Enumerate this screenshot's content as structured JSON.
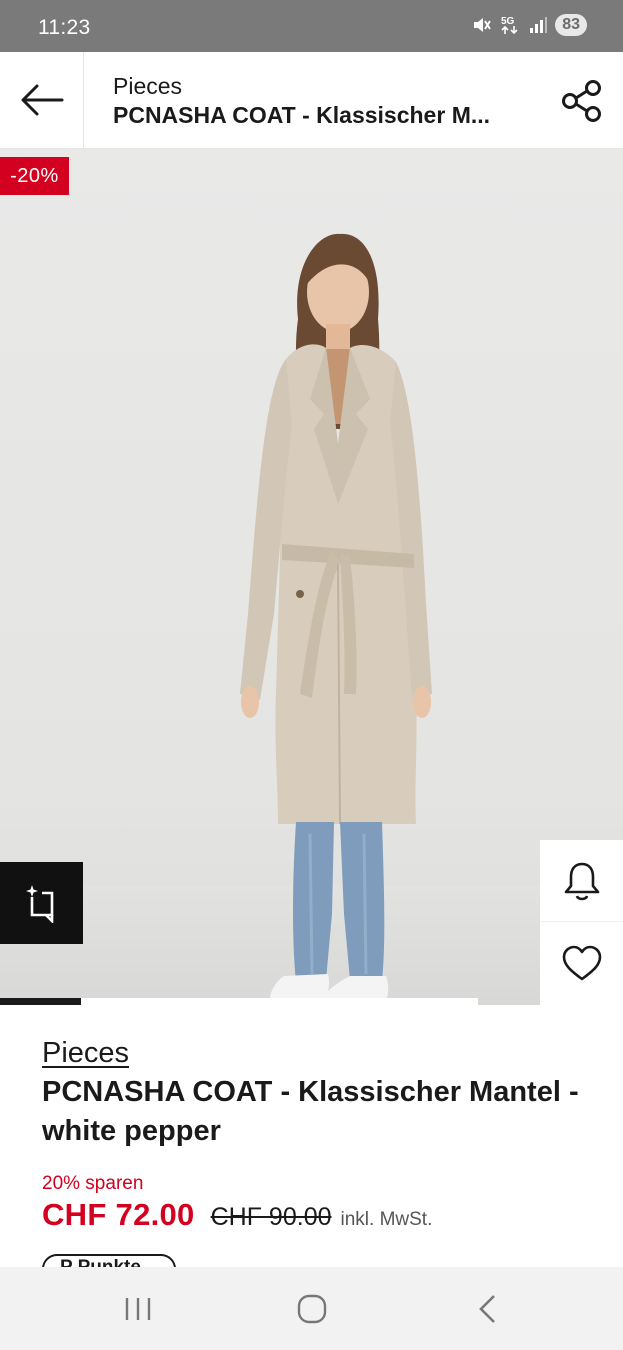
{
  "status_bar": {
    "time": "11:23",
    "battery": "83",
    "icons": [
      "mute-icon",
      "5g-icon",
      "signal-icon",
      "battery-icon"
    ]
  },
  "header": {
    "brand": "Pieces",
    "product_title": "PCNASHA COAT - Klassischer M..."
  },
  "image": {
    "discount_badge": "-20%",
    "carousel_progress": 0.17
  },
  "product": {
    "brand": "Pieces",
    "name": "PCNASHA COAT - Klassischer Mantel - white pepper",
    "savings": "20% sparen",
    "price": "CHF 72.00",
    "original_price": "CHF 90.00",
    "tax_note": "inkl. MwSt.",
    "points_label": "P Punkte"
  },
  "colors": {
    "accent": "#d4001f",
    "text": "#1a1a1a",
    "status_bar": "#7a7a7a",
    "coat": "#d8cdbd",
    "jeans": "#7f9cbd"
  }
}
